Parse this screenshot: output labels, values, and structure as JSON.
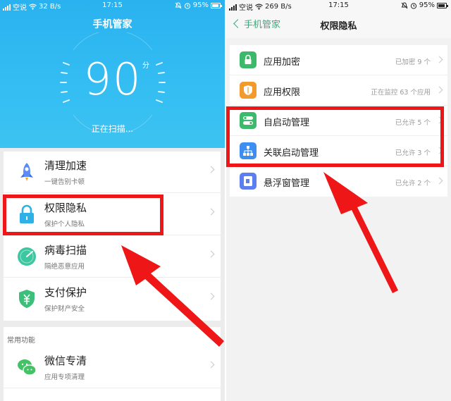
{
  "left": {
    "status": {
      "carrier": "空说",
      "speed": "32 B/s",
      "time": "17:15",
      "battery": "95%"
    },
    "title": "手机管家",
    "score": "90",
    "score_unit": "分",
    "scan_status": "正在扫描...",
    "items": [
      {
        "title": "清理加速",
        "subtitle": "一键告别卡顿",
        "icon": "rocket-icon"
      },
      {
        "title": "权限隐私",
        "subtitle": "保护个人隐私",
        "icon": "lock-icon"
      },
      {
        "title": "病毒扫描",
        "subtitle": "隔绝恶意应用",
        "icon": "radar-icon"
      },
      {
        "title": "支付保护",
        "subtitle": "保护财产安全",
        "icon": "yuan-shield-icon"
      }
    ],
    "section_title": "常用功能",
    "common": [
      {
        "title": "微信专清",
        "subtitle": "应用专项清理",
        "icon": "wechat-icon"
      }
    ]
  },
  "right": {
    "status": {
      "carrier": "空说",
      "speed": "269 B/s",
      "time": "17:15",
      "battery": "95%"
    },
    "back_label": "手机管家",
    "title": "权限隐私",
    "items": [
      {
        "label": "应用加密",
        "status": "已加密 9 个",
        "icon": "app-lock-icon",
        "color": "#3cb96a"
      },
      {
        "label": "应用权限",
        "status": "正在监控 63 个应用",
        "icon": "permission-shield-icon",
        "color": "#f29b2c"
      },
      {
        "label": "自启动管理",
        "status": "已允许 5 个",
        "icon": "toggle-icon",
        "color": "#3cb96a"
      },
      {
        "label": "关联启动管理",
        "status": "已允许 3 个",
        "icon": "hierarchy-icon",
        "color": "#3d8ef0"
      },
      {
        "label": "悬浮窗管理",
        "status": "已允许 2 个",
        "icon": "floating-window-icon",
        "color": "#5b7ff0"
      }
    ]
  },
  "colors": {
    "hero_blue": "#2fb7f0",
    "accent_green": "#3aab7d",
    "annotation_red": "#ee1616"
  }
}
